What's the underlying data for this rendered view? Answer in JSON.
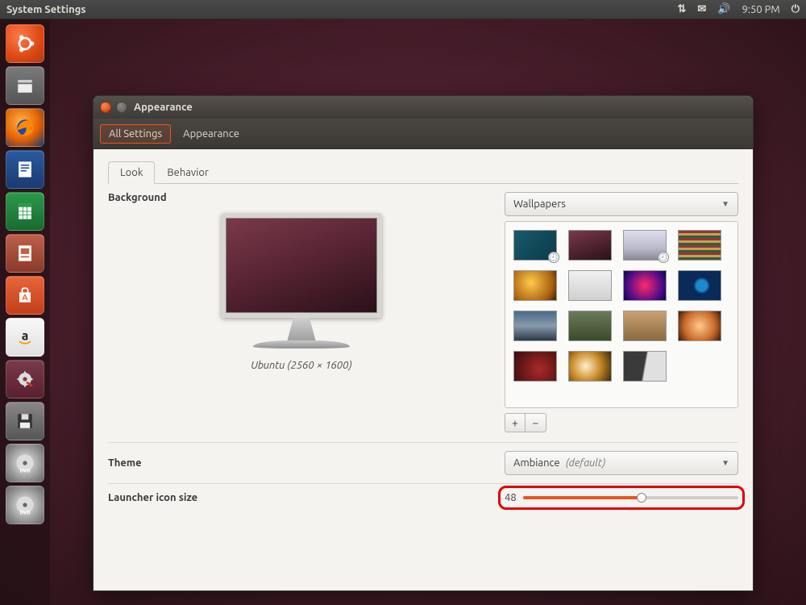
{
  "menubar": {
    "title": "System Settings",
    "clock": "9:50 PM"
  },
  "launcher_items": [
    {
      "name": "ubuntu-dash",
      "cls": "ubuntu"
    },
    {
      "name": "files",
      "cls": "files"
    },
    {
      "name": "firefox",
      "cls": "firefox"
    },
    {
      "name": "libreoffice-writer",
      "cls": "writer"
    },
    {
      "name": "libreoffice-calc",
      "cls": "calc"
    },
    {
      "name": "libreoffice-impress",
      "cls": "impress"
    },
    {
      "name": "ubuntu-software",
      "cls": "software"
    },
    {
      "name": "amazon",
      "cls": "amazon"
    },
    {
      "name": "system-settings",
      "cls": "settings"
    },
    {
      "name": "floppy-disk",
      "cls": "disk"
    },
    {
      "name": "dvd-1",
      "cls": "dvd"
    },
    {
      "name": "dvd-2",
      "cls": "dvd"
    }
  ],
  "window": {
    "title": "Appearance",
    "breadcrumbs": {
      "all": "All Settings",
      "current": "Appearance"
    },
    "tabs": {
      "look": "Look",
      "behavior": "Behavior",
      "active": "look"
    },
    "background": {
      "label": "Background",
      "preview_caption": "Ubuntu (2560 × 1600)",
      "source_label": "Wallpapers",
      "add_label": "+",
      "remove_label": "−"
    },
    "theme": {
      "label": "Theme",
      "value": "Ambiance",
      "suffix": "(default)"
    },
    "launcher_size": {
      "label": "Launcher icon size",
      "value": "48"
    }
  }
}
